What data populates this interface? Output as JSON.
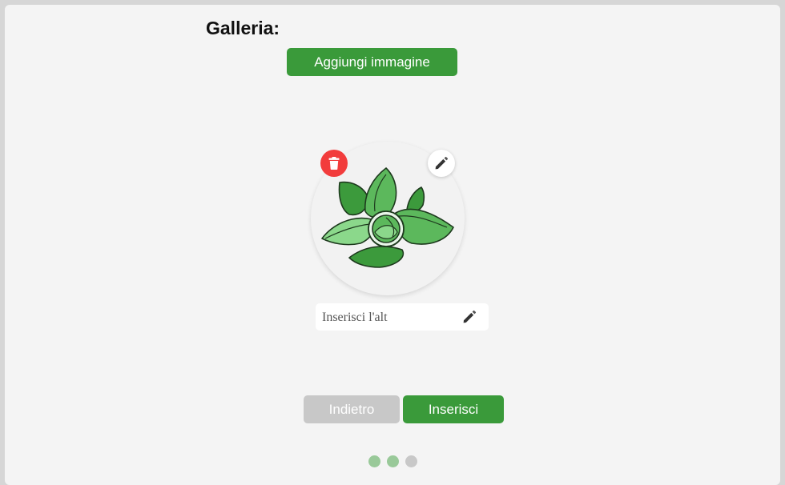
{
  "gallery": {
    "title": "Galleria:",
    "add_button_label": "Aggiungi immagine",
    "image_icon": "lotus-leaf-logo"
  },
  "image_card": {
    "delete_icon": "trash-icon",
    "edit_icon": "pencil-icon",
    "alt_input": {
      "value": "",
      "placeholder": "Inserisci l'alt"
    },
    "alt_edit_icon": "pencil-icon"
  },
  "navigation": {
    "back_label": "Indietro",
    "insert_label": "Inserisci"
  },
  "steps": {
    "count": 3,
    "current": 2,
    "active_color": "#99c999",
    "inactive_color": "#c8c8c8"
  },
  "colors": {
    "primary_green": "#3a9a3a",
    "disabled_gray": "#c8c8c8",
    "delete_red": "#f23c3c"
  }
}
